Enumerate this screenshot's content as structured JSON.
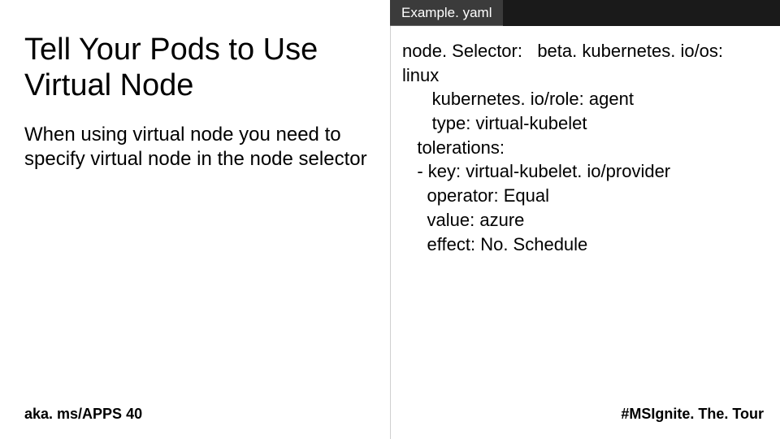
{
  "left": {
    "title": "Tell Your Pods to Use Virtual Node",
    "subtitle": "When using virtual node you need to specify virtual node in the node selector"
  },
  "tab": {
    "label": "Example. yaml"
  },
  "code": {
    "lines": [
      "node. Selector:   beta. kubernetes. io/os:",
      "linux",
      "      kubernetes. io/role: agent",
      "      type: virtual-kubelet",
      "   tolerations:",
      "   - key: virtual-kubelet. io/provider",
      "     operator: Equal",
      "     value: azure",
      "     effect: No. Schedule"
    ]
  },
  "footer": {
    "left": "aka. ms/APPS 40",
    "right": "#MSIgnite. The. Tour"
  }
}
